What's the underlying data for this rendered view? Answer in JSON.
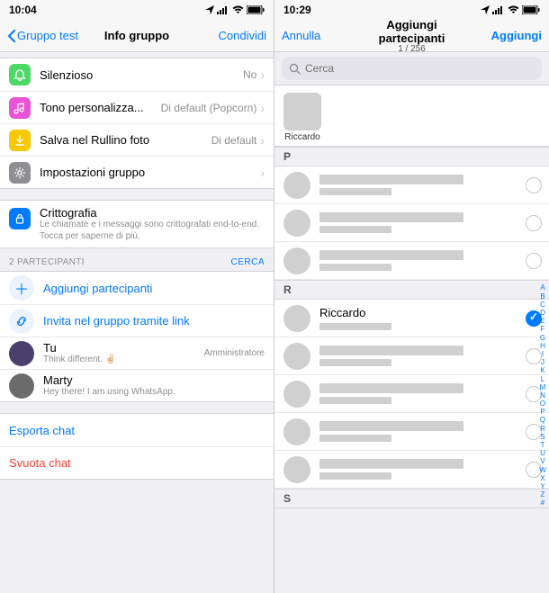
{
  "left": {
    "status": {
      "time": "10:04"
    },
    "nav": {
      "back": "Gruppo test",
      "title": "Info gruppo",
      "action": "Condividi"
    },
    "settings": [
      {
        "key": "silent",
        "label": "Silenzioso",
        "value": "No",
        "icon": "bell-icon",
        "color": "green"
      },
      {
        "key": "tone",
        "label": "Tono personalizza...",
        "value": "Di default (Popcorn)",
        "icon": "music-icon",
        "color": "pink"
      },
      {
        "key": "save",
        "label": "Salva nel Rullino foto",
        "value": "Di default",
        "icon": "download-icon",
        "color": "yellow"
      },
      {
        "key": "groupset",
        "label": "Impostazioni gruppo",
        "value": "",
        "icon": "gear-icon",
        "color": "gray"
      }
    ],
    "crypto": {
      "title": "Crittografia",
      "sub": "Le chiamate e i messaggi sono crittografati end-to-end. Tocca per saperne di più."
    },
    "participants_header": "2 PARTECIPANTI",
    "search_label": "CERCA",
    "actions": {
      "add": "Aggiungi partecipanti",
      "invite": "Invita nel gruppo tramite link"
    },
    "members": [
      {
        "name": "Tu",
        "status": "Think different. ✌🏻",
        "role": "Amministratore",
        "avatar_color": "#4a3f6d"
      },
      {
        "name": "Marty",
        "status": "Hey there! I am using WhatsApp.",
        "role": "",
        "avatar_color": "#6b6b6b"
      }
    ],
    "footer": {
      "export": "Esporta chat",
      "clear": "Svuota chat"
    }
  },
  "right": {
    "status": {
      "time": "10:29"
    },
    "nav": {
      "cancel": "Annulla",
      "title": "Aggiungi partecipanti",
      "count": "1 / 256",
      "action": "Aggiungi"
    },
    "search_placeholder": "Cerca",
    "selected": [
      {
        "name": "Riccardo"
      }
    ],
    "sections": [
      {
        "letter": "P",
        "contacts": [
          {
            "name": "",
            "selected": false
          },
          {
            "name": "",
            "selected": false
          },
          {
            "name": "",
            "selected": false
          }
        ]
      },
      {
        "letter": "R",
        "contacts": [
          {
            "name": "Riccardo",
            "selected": true
          },
          {
            "name": "",
            "selected": false
          },
          {
            "name": "",
            "selected": false
          },
          {
            "name": "",
            "selected": false
          },
          {
            "name": "",
            "selected": false
          }
        ]
      },
      {
        "letter": "S",
        "contacts": []
      }
    ],
    "index": [
      "A",
      "B",
      "C",
      "D",
      "E",
      "F",
      "G",
      "H",
      "I",
      "J",
      "K",
      "L",
      "M",
      "N",
      "O",
      "P",
      "Q",
      "R",
      "S",
      "T",
      "U",
      "V",
      "W",
      "X",
      "Y",
      "Z",
      "#"
    ]
  }
}
